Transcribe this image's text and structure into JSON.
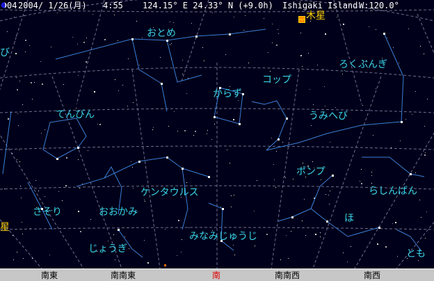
{
  "status": {
    "date_code": "04",
    "date": "2004/ 1/26(月)",
    "time": "4:55",
    "location_coords": "124.15° E 24.33° N (+9.0h)",
    "location_name": "Ishigaki Island",
    "field_of_view": "W:120.0°"
  },
  "colors": {
    "sky_background": "#00001a",
    "constellation_lines": "#3b7fd6",
    "grid_lines": "#8a8ab0",
    "constellation_labels": "#39d3e6",
    "planet_label": "#ffd200",
    "south_direction": "#e00000",
    "direction_bar": "#c7c7c7"
  },
  "planet": {
    "name": "木星",
    "icon": "jupiter-icon"
  },
  "constellations": {
    "otome": "おとめ",
    "karasu": "からず",
    "koppu": "コップ",
    "rokubungi": "ろくぶんぎ",
    "tenbin": "てんびん",
    "umihebi": "うみへび",
    "ponpu": "ポンプ",
    "kentaurusu": "ケンタウルス",
    "rashinban": "らしんばん",
    "sasori": "さそり",
    "ookami": "おおかみ",
    "ho": "ほ",
    "minamijuujikai": "みなみじゅうじ",
    "jougi": "じょうぎ",
    "tomo": "とも",
    "edge_east": "び",
    "edge_west": "星"
  },
  "directions": {
    "southeast": "南東",
    "south_southeast": "南南東",
    "south": "南",
    "south_southwest": "南南西",
    "southwest": "南西"
  }
}
